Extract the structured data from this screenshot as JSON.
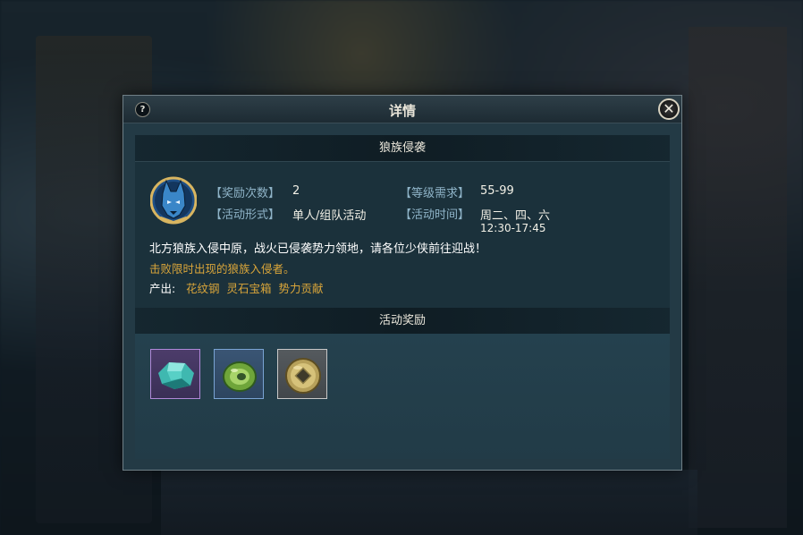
{
  "dialog": {
    "title": "详情",
    "help_label": "?",
    "close_label": "✕"
  },
  "activity": {
    "name": "狼族侵袭",
    "reward_count_label": "【奖励次数】",
    "reward_count_value": "2",
    "level_req_label": "【等级需求】",
    "level_req_value": "55-99",
    "format_label": "【活动形式】",
    "format_value": "单人/组队活动",
    "time_label": "【活动时间】",
    "time_days": "周二、四、六",
    "time_hours": "12:30-17:45",
    "description": "北方狼族入侵中原，战火已侵袭势力领地，请各位少侠前往迎战！",
    "task": "击败限时出现的狼族入侵者。",
    "output_label": "产出:",
    "output_items": "花纹钢 灵石宝箱 势力贡献"
  },
  "rewards": {
    "heading": "活动奖励",
    "items": [
      {
        "icon": "jade-stone-icon",
        "rarity_color": "#b088d8"
      },
      {
        "icon": "green-ring-icon",
        "rarity_color": "#7aa4d4"
      },
      {
        "icon": "bronze-coin-icon",
        "rarity_color": "#c8c8c8"
      }
    ]
  },
  "colors": {
    "label": "#8fb4c8",
    "highlight": "#d9a53a",
    "panel": "#233a45"
  }
}
